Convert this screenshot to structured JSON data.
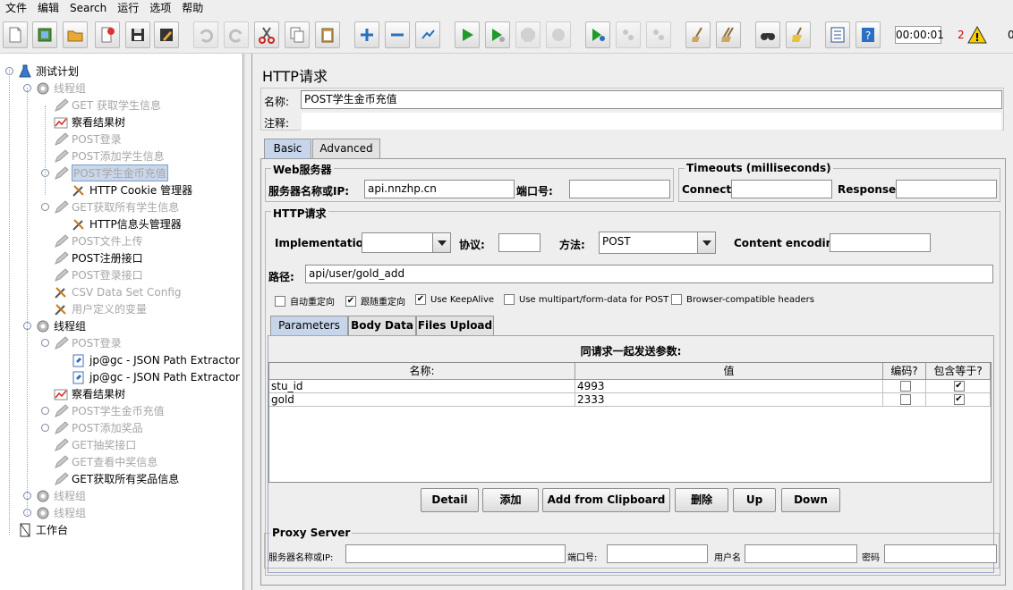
{
  "menu": [
    "文件",
    "编辑",
    "Search",
    "运行",
    "选项",
    "帮助"
  ],
  "toolbar": {
    "buttons": [
      "new-icon",
      "templates-icon",
      "open-icon",
      "close-icon",
      "save-icon",
      "save-as-icon",
      "undo-icon",
      "redo-icon",
      "cut-icon",
      "copy-icon",
      "paste-icon",
      "expand-icon",
      "collapse-icon",
      "toggle-icon",
      "start-icon",
      "start-no-pause-icon",
      "stop-icon",
      "shutdown-icon",
      "remote-start-icon",
      "remote-stop-icon",
      "remote-shutdown-icon",
      "clear-icon",
      "clear-all-icon",
      "search-icon",
      "reset-search-icon",
      "function-helper-icon",
      "help-icon"
    ],
    "timer": "00:00:01",
    "error_count": "2",
    "active_threads": "0"
  },
  "tree": {
    "nodes": [
      {
        "label": "测试计划",
        "icon": "flask-icon",
        "level": 0,
        "disabled": false,
        "expander": true
      },
      {
        "label": "线程组",
        "icon": "gear-icon",
        "level": 1,
        "disabled": true,
        "expander": true
      },
      {
        "label": "GET 获取学生信息",
        "icon": "pencil-icon",
        "level": 2,
        "disabled": true
      },
      {
        "label": "察看结果树",
        "icon": "chart-icon",
        "level": 2,
        "disabled": false
      },
      {
        "label": "POST登录",
        "icon": "pencil-icon",
        "level": 2,
        "disabled": true
      },
      {
        "label": "POST添加学生信息",
        "icon": "pencil-icon",
        "level": 2,
        "disabled": true
      },
      {
        "label": "POST学生金币充值",
        "icon": "pencil-icon",
        "level": 2,
        "disabled": true,
        "selected": true,
        "expander": true
      },
      {
        "label": "HTTP Cookie 管理器",
        "icon": "tools-icon",
        "level": 3,
        "disabled": false
      },
      {
        "label": "GET获取所有学生信息",
        "icon": "pencil-icon",
        "level": 2,
        "disabled": true,
        "expander": true
      },
      {
        "label": "HTTP信息头管理器",
        "icon": "tools-icon",
        "level": 3,
        "disabled": false
      },
      {
        "label": "POST文件上传",
        "icon": "pencil-icon",
        "level": 2,
        "disabled": true
      },
      {
        "label": "POST注册接口",
        "icon": "pencil-icon",
        "level": 2,
        "disabled": false
      },
      {
        "label": "POST登录接口",
        "icon": "pencil-icon",
        "level": 2,
        "disabled": true
      },
      {
        "label": "CSV Data Set Config",
        "icon": "tools-icon",
        "level": 2,
        "disabled": true
      },
      {
        "label": "用户定义的变量",
        "icon": "tools-icon",
        "level": 2,
        "disabled": true
      },
      {
        "label": "线程组",
        "icon": "gear-icon",
        "level": 1,
        "disabled": false,
        "expander": true
      },
      {
        "label": "POST登录",
        "icon": "pencil-icon",
        "level": 2,
        "disabled": true,
        "expander": true
      },
      {
        "label": "jp@gc - JSON Path Extractor",
        "icon": "extractor-icon",
        "level": 3,
        "disabled": false
      },
      {
        "label": "jp@gc - JSON Path Extractor",
        "icon": "extractor-icon",
        "level": 3,
        "disabled": false
      },
      {
        "label": "察看结果树",
        "icon": "chart-icon",
        "level": 2,
        "disabled": false
      },
      {
        "label": "POST学生金币充值",
        "icon": "pencil-icon",
        "level": 2,
        "disabled": true,
        "expander": true
      },
      {
        "label": "POST添加奖品",
        "icon": "pencil-icon",
        "level": 2,
        "disabled": true,
        "expander": true
      },
      {
        "label": "GET抽奖接口",
        "icon": "pencil-icon",
        "level": 2,
        "disabled": true
      },
      {
        "label": "GET查看中奖信息",
        "icon": "pencil-icon",
        "level": 2,
        "disabled": true
      },
      {
        "label": "GET获取所有奖品信息",
        "icon": "pencil-icon",
        "level": 2,
        "disabled": false
      },
      {
        "label": "线程组",
        "icon": "gear-icon",
        "level": 1,
        "disabled": true,
        "expander": true
      },
      {
        "label": "线程组",
        "icon": "gear-icon",
        "level": 1,
        "disabled": true,
        "expander": true
      },
      {
        "label": "工作台",
        "icon": "workbench-icon",
        "level": 0,
        "disabled": false
      }
    ]
  },
  "sampler": {
    "title": "HTTP请求",
    "name_label": "名称:",
    "name_value": "POST学生金币充值",
    "comment_label": "注释:",
    "comment_value": "",
    "tabs": [
      "Basic",
      "Advanced"
    ],
    "web_server": {
      "title": "Web服务器",
      "server_label": "服务器名称或IP:",
      "server_value": "api.nnzhp.cn",
      "port_label": "端口号:",
      "port_value": ""
    },
    "timeouts": {
      "title": "Timeouts (milliseconds)",
      "connect_label": "Connect:",
      "connect_value": "",
      "response_label": "Response:",
      "response_value": ""
    },
    "http_request": {
      "title": "HTTP请求",
      "implementation_label": "Implementation:",
      "implementation_value": "",
      "protocol_label": "协议:",
      "protocol_value": "",
      "method_label": "方法:",
      "method_value": "POST",
      "encoding_label": "Content encoding:",
      "encoding_value": "",
      "path_label": "路径:",
      "path_value": "api/user/gold_add"
    },
    "options": [
      {
        "label": "自动重定向",
        "checked": false
      },
      {
        "label": "跟随重定向",
        "checked": true
      },
      {
        "label": "Use KeepAlive",
        "checked": true
      },
      {
        "label": "Use multipart/form-data for POST",
        "checked": false
      },
      {
        "label": "Browser-compatible headers",
        "checked": false
      }
    ],
    "param_tabs": [
      "Parameters",
      "Body Data",
      "Files Upload"
    ],
    "params_caption": "同请求一起发送参数:",
    "params_headers": [
      "名称:",
      "值",
      "编码?",
      "包含等于?"
    ],
    "params_rows": [
      {
        "name": "stu_id",
        "value": "4993",
        "encode": false,
        "include_equals": true
      },
      {
        "name": "gold",
        "value": "2333",
        "encode": false,
        "include_equals": true
      }
    ],
    "buttons": [
      "Detail",
      "添加",
      "Add from Clipboard",
      "删除",
      "Up",
      "Down"
    ],
    "proxy": {
      "title": "Proxy Server",
      "server_label": "服务器名称或IP:",
      "port_label": "端口号:",
      "user_label": "用户名",
      "password_label": "密码",
      "server_value": "",
      "port_value": "",
      "user_value": "",
      "password_value": ""
    }
  },
  "colors": {
    "selection": "#c9d7ea",
    "active_tab": "#c6d5ea",
    "error": "#d00000",
    "disabled_text": "#a6a6a6"
  }
}
